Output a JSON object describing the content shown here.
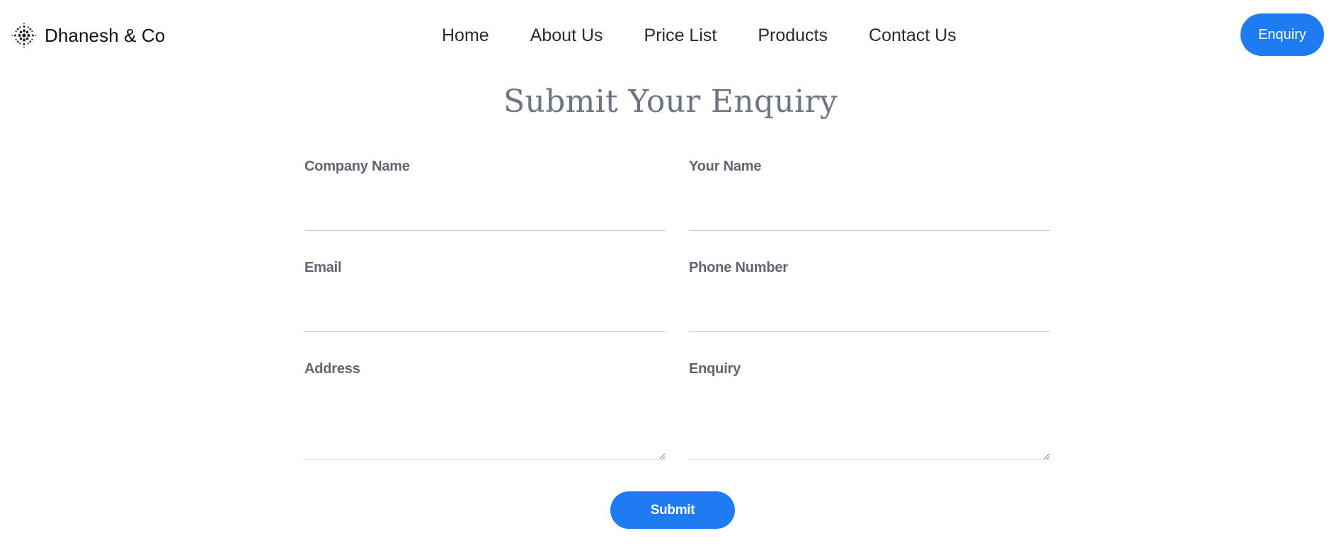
{
  "header": {
    "brand_name": "Dhanesh & Co",
    "brand_icon": "sparkle-dots-logo-icon",
    "nav": [
      {
        "label": "Home"
      },
      {
        "label": "About Us"
      },
      {
        "label": "Price List"
      },
      {
        "label": "Products"
      },
      {
        "label": "Contact Us"
      }
    ],
    "enquiry_button": "Enquiry"
  },
  "form": {
    "title": "Submit Your Enquiry",
    "fields": {
      "company_name": {
        "label": "Company Name",
        "value": ""
      },
      "your_name": {
        "label": "Your Name",
        "value": ""
      },
      "email": {
        "label": "Email",
        "value": ""
      },
      "phone_number": {
        "label": "Phone Number",
        "value": ""
      },
      "address": {
        "label": "Address",
        "value": ""
      },
      "enquiry": {
        "label": "Enquiry",
        "value": ""
      }
    },
    "submit_label": "Submit"
  },
  "colors": {
    "accent": "#1f7bf2",
    "title": "#6c7580",
    "label": "#5f6670",
    "underline": "#c9cdd2"
  }
}
